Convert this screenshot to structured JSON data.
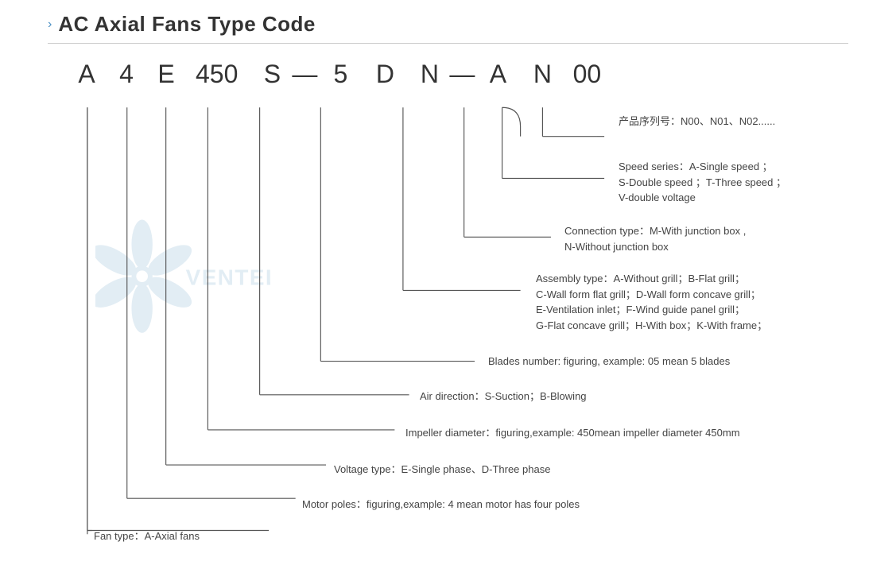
{
  "header": {
    "chevron": "›",
    "title": "AC Axial Fans Type Code"
  },
  "typeCode": {
    "letters": [
      "A",
      "4",
      "E",
      "450",
      "S",
      "—",
      "5",
      "D",
      "N",
      "—",
      "A",
      "N",
      "00"
    ]
  },
  "annotations": {
    "product_series": {
      "label": "产品序列号：N00、N01、N02......"
    },
    "speed_series": {
      "label": "Speed series：A-Single speed ；",
      "line2": "S-Double speed ；T-Three speed ；",
      "line3": "V-double voltage"
    },
    "connection_type": {
      "label": "Connection type：M-With junction box ,",
      "line2": "N-Without junction box"
    },
    "assembly_type": {
      "label": "Assembly type：A-Without grill；B-Flat grill；",
      "line2": "C-Wall form flat grill；D-Wall form concave grill；",
      "line3": "E-Ventilation inlet；F-Wind guide panel grill；",
      "line4": "G-Flat concave grill；H-With box；K-With frame；"
    },
    "blades_number": {
      "label": "Blades number: figuring, example: 05 mean 5 blades"
    },
    "air_direction": {
      "label": "Air direction：S-Suction；B-Blowing"
    },
    "impeller_diameter": {
      "label": "Impeller diameter：figuring,example: 450mean impeller diameter 450mm"
    },
    "voltage_type": {
      "label": "Voltage type：E-Single phase、D-Three phase"
    },
    "motor_poles": {
      "label": "Motor poles：figuring,example: 4 mean motor has four poles"
    },
    "fan_type": {
      "label": "Fan type：A-Axial fans"
    }
  },
  "watermark": {
    "text": "VENTEL"
  }
}
